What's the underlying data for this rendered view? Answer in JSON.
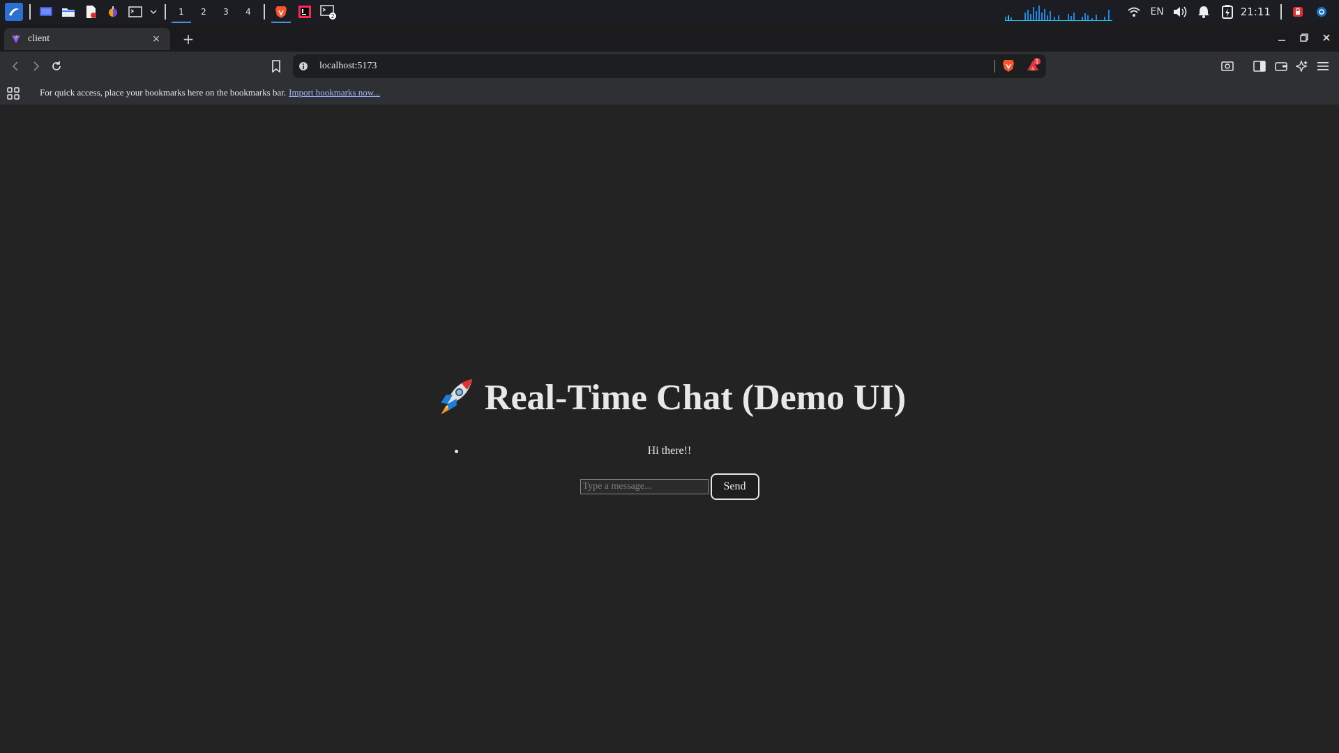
{
  "taskbar": {
    "workspaces": [
      "1",
      "2",
      "3",
      "4"
    ],
    "active_workspace": "1",
    "language": "EN",
    "clock": "21:11",
    "terminal_badge": "2"
  },
  "browser": {
    "tab_title": "client",
    "tab_close": "×",
    "new_tab": "+",
    "url": "localhost:5173",
    "shields_badge": "1",
    "colors": {
      "tab_bg": "#2f3033",
      "omnibox_bg": "#1d1e20",
      "page_bg": "#232323"
    }
  },
  "bookmarks_bar": {
    "message": "For quick access, place your bookmarks here on the bookmarks bar.",
    "import_link": "Import bookmarks now..."
  },
  "chat": {
    "title": "Real-Time Chat (Demo UI)",
    "title_icon": "rocket-emoji",
    "messages": [
      "Hi there!!"
    ],
    "input_placeholder": "Type a message...",
    "input_value": "",
    "send_label": "Send"
  }
}
